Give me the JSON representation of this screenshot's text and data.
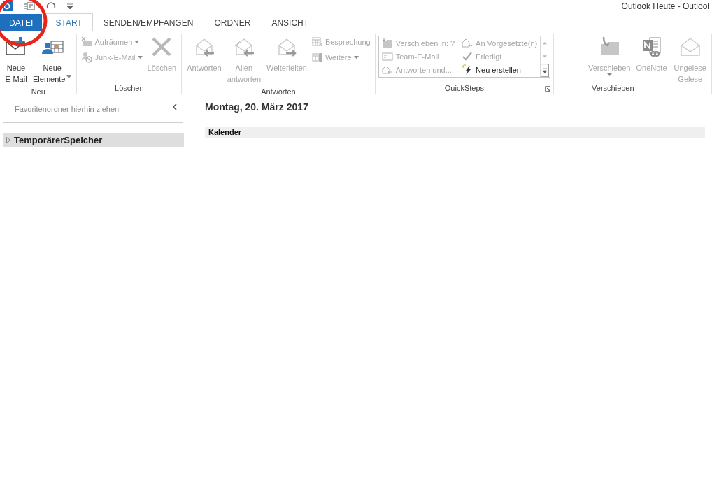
{
  "window": {
    "title": "Outlook Heute - Outlool"
  },
  "tabs": [
    {
      "label": "DATEI",
      "kind": "file",
      "selected": false
    },
    {
      "label": "START",
      "kind": "tab",
      "selected": true
    },
    {
      "label": "SENDEN/EMPFANGEN",
      "kind": "tab",
      "selected": false
    },
    {
      "label": "ORDNER",
      "kind": "tab",
      "selected": false
    },
    {
      "label": "ANSICHT",
      "kind": "tab",
      "selected": false
    }
  ],
  "ribbon": {
    "groups": [
      {
        "label": "Neu",
        "items": [
          {
            "kind": "large",
            "lines": [
              "Neue",
              "E-Mail"
            ],
            "dropdown": false,
            "disabled": false
          },
          {
            "kind": "large",
            "lines": [
              "Neue",
              "Elemente"
            ],
            "dropdown": true,
            "disabled": false
          }
        ]
      },
      {
        "label": "Löschen",
        "items": [
          {
            "kind": "stack",
            "items": [
              {
                "label": "Aufräumen",
                "dropdown": true,
                "disabled": true
              },
              {
                "label": "Junk-E-Mail",
                "dropdown": true,
                "disabled": true
              }
            ]
          },
          {
            "kind": "large",
            "lines": [
              "Löschen"
            ],
            "dropdown": false,
            "disabled": true
          }
        ]
      },
      {
        "label": "Antworten",
        "items": [
          {
            "kind": "large",
            "lines": [
              "Antworten"
            ],
            "dropdown": false,
            "disabled": true
          },
          {
            "kind": "large",
            "lines": [
              "Allen",
              "antworten"
            ],
            "dropdown": false,
            "disabled": true
          },
          {
            "kind": "large",
            "lines": [
              "Weiterleiten"
            ],
            "dropdown": false,
            "disabled": true
          },
          {
            "kind": "stack",
            "items": [
              {
                "label": "Besprechung",
                "dropdown": false,
                "disabled": true
              },
              {
                "label": "Weitere",
                "dropdown": true,
                "disabled": true
              }
            ]
          }
        ]
      },
      {
        "label": "QuickSteps",
        "launcher": true,
        "items": [
          {
            "kind": "gallery",
            "items": [
              {
                "label": "Verschieben in: ?",
                "disabled": true
              },
              {
                "label": "An Vorgesetzte(n)",
                "disabled": true
              },
              {
                "label": "Team-E-Mail",
                "disabled": true
              },
              {
                "label": "Erledigt",
                "disabled": true
              },
              {
                "label": "Antworten und...",
                "disabled": true
              },
              {
                "label": "Neu erstellen",
                "disabled": false
              }
            ]
          }
        ]
      },
      {
        "label": "Verschieben",
        "items": [
          {
            "kind": "large",
            "lines": [
              "Verschieben"
            ],
            "dropdown": true,
            "disabled": true
          },
          {
            "kind": "large",
            "lines": [
              "OneNote"
            ],
            "dropdown": false,
            "disabled": true
          }
        ]
      },
      {
        "items": [
          {
            "kind": "large",
            "lines": [
              "Ungelese",
              "Gelese"
            ],
            "dropdown": false,
            "disabled": true
          }
        ]
      }
    ]
  },
  "navigation": {
    "favorites_hint": "Favoritenordner hierhin ziehen",
    "folders": [
      {
        "label": "TemporärerSpeicher",
        "selected": true,
        "expanded": false
      }
    ]
  },
  "content": {
    "heading": "Montag, 20. März 2017",
    "sections": [
      {
        "label": "Kalender"
      }
    ]
  },
  "annotations": [
    {
      "kind": "ellipse",
      "color": "#e8251b"
    }
  ]
}
